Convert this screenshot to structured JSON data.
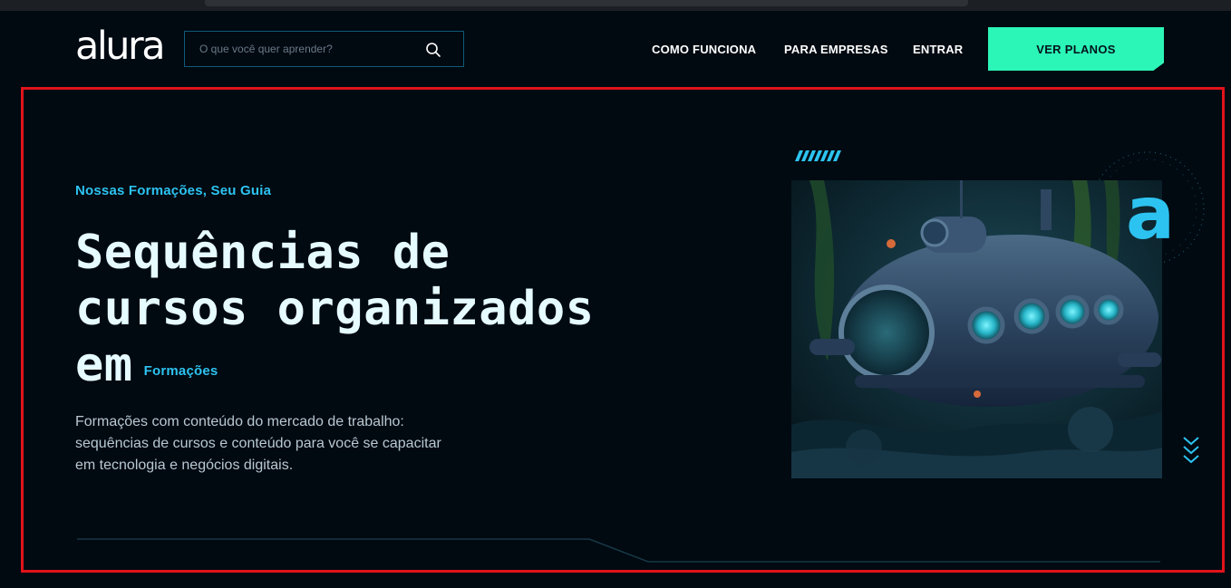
{
  "header": {
    "logo": "alura",
    "search_placeholder": "O que você quer aprender?",
    "nav": [
      "COMO FUNCIONA",
      "PARA EMPRESAS",
      "ENTRAR"
    ],
    "cta_label": "VER PLANOS"
  },
  "hero": {
    "eyebrow": "Nossas Formações, Seu Guia",
    "headline_line1": "Sequências de",
    "headline_line2": "cursos organizados",
    "headline_line3": "em",
    "headline_tag": "Formações",
    "description": "Formações com conteúdo do mercado de trabalho: sequências de cursos e conteúdo para você se capacitar em tecnologia e negócios digitais.",
    "badge_letter": "a"
  },
  "colors": {
    "accent": "#2bf6b7",
    "highlight_text": "#2dc3f0",
    "background": "#010911",
    "outline": "#e0131b"
  },
  "icons": {
    "search": "search-icon",
    "scroll": "chevrons-down-icon"
  }
}
